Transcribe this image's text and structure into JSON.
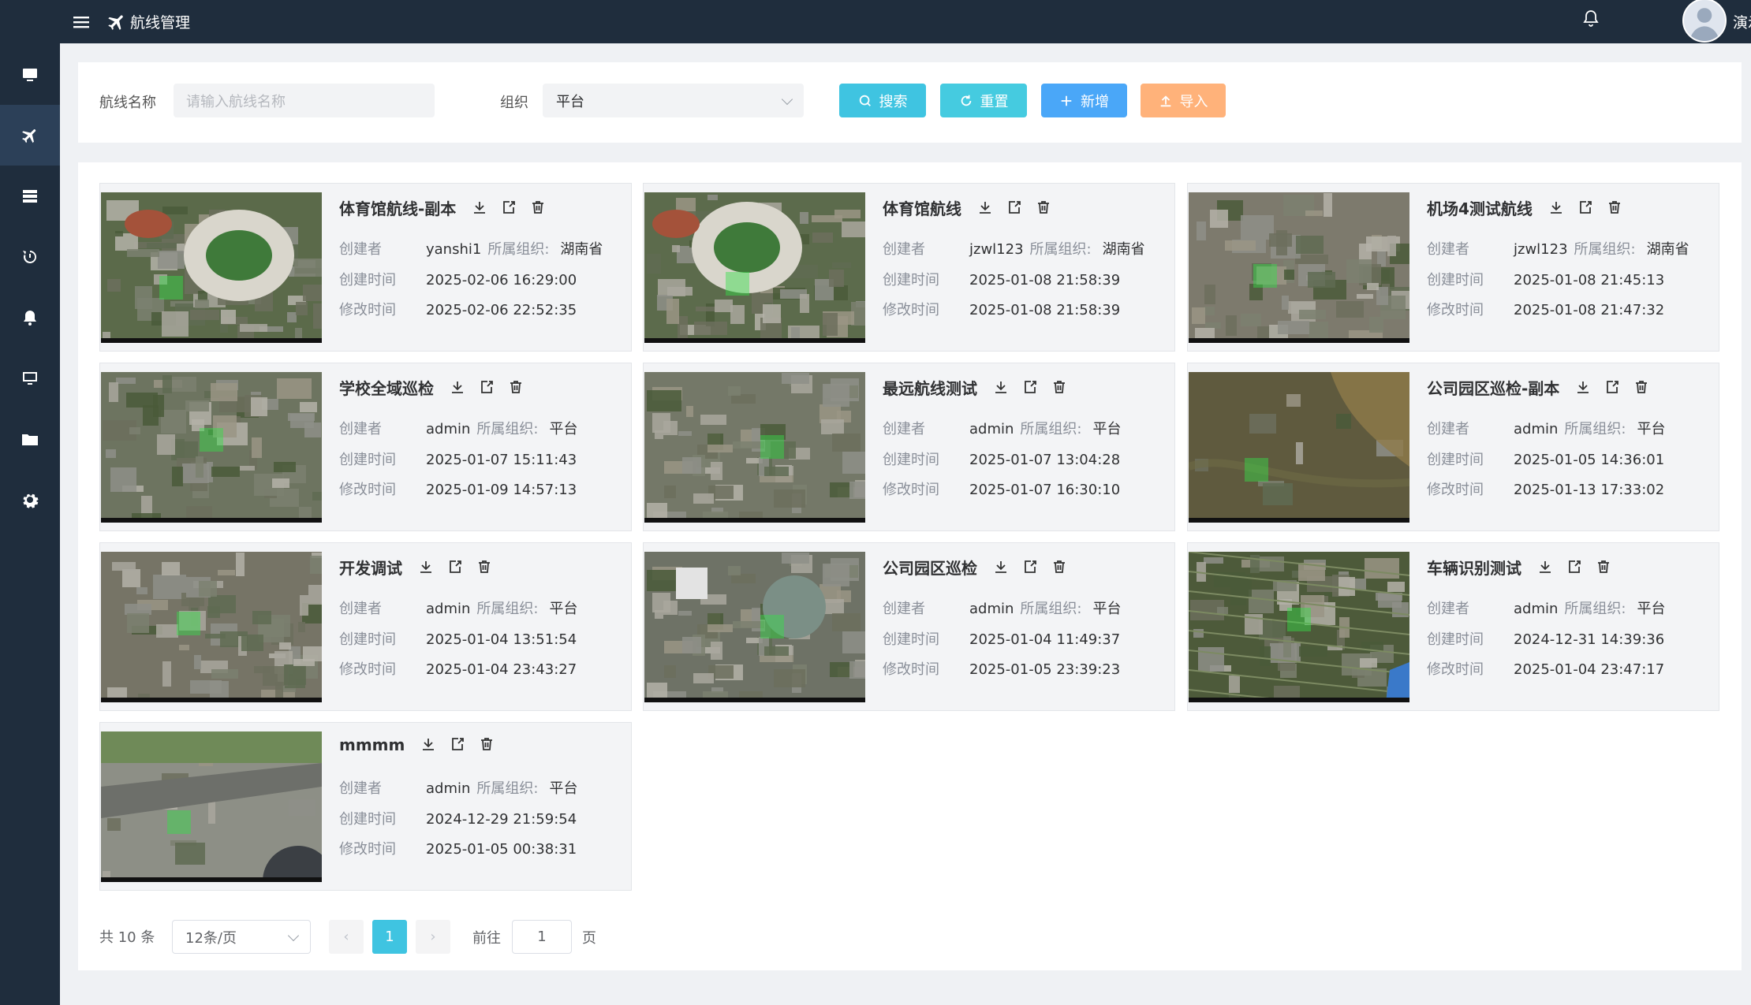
{
  "header": {
    "title": "航线管理",
    "user": "演示管理员"
  },
  "sidebar": {
    "items": [
      "monitor-icon",
      "plane-icon",
      "server-icon",
      "history-icon",
      "bell-icon",
      "screen-icon",
      "folder-icon",
      "gear-icon"
    ],
    "active_index": 1
  },
  "search": {
    "route_label": "航线名称",
    "route_placeholder": "请输入航线名称",
    "org_label": "组织",
    "org_value": "平台",
    "search_btn": "搜索",
    "reset_btn": "重置",
    "add_btn": "新增",
    "import_btn": "导入"
  },
  "colors": {
    "search": "#3fc4e1",
    "reset": "#45cbe0",
    "add": "#4aa7f8",
    "import": "#ffb27a"
  },
  "labels": {
    "creator": "创建者",
    "created": "创建时间",
    "modified": "修改时间",
    "org": "所属组织:"
  },
  "cards": [
    {
      "name": "体育馆航线-副本",
      "creator": "yanshi1",
      "org": "湖南省",
      "created": "2025-02-06 16:29:00",
      "modified": "2025-02-06 22:52:35",
      "thumb": "stadium"
    },
    {
      "name": "体育馆航线",
      "creator": "jzwl123",
      "org": "湖南省",
      "created": "2025-01-08 21:58:39",
      "modified": "2025-01-08 21:58:39",
      "thumb": "stadium2"
    },
    {
      "name": "机场4测试航线",
      "creator": "jzwl123",
      "org": "湖南省",
      "created": "2025-01-08 21:45:13",
      "modified": "2025-01-08 21:47:32",
      "thumb": "industrial"
    },
    {
      "name": "学校全域巡检",
      "creator": "admin",
      "org": "平台",
      "created": "2025-01-07 15:11:43",
      "modified": "2025-01-09 14:57:13",
      "thumb": "school"
    },
    {
      "name": "最远航线测试",
      "creator": "admin",
      "org": "平台",
      "created": "2025-01-07 13:04:28",
      "modified": "2025-01-07 16:30:10",
      "thumb": "city"
    },
    {
      "name": "公司园区巡检-副本",
      "creator": "admin",
      "org": "平台",
      "created": "2025-01-05 14:36:01",
      "modified": "2025-01-13 17:33:02",
      "thumb": "terrain"
    },
    {
      "name": "开发调试",
      "creator": "admin",
      "org": "平台",
      "created": "2025-01-04 13:51:54",
      "modified": "2025-01-04 23:43:27",
      "thumb": "city2"
    },
    {
      "name": "公司园区巡检",
      "creator": "admin",
      "org": "平台",
      "created": "2025-01-04 11:49:37",
      "modified": "2025-01-05 23:39:23",
      "thumb": "park"
    },
    {
      "name": "车辆识别测试",
      "creator": "admin",
      "org": "平台",
      "created": "2024-12-31 14:39:36",
      "modified": "2025-01-04 23:47:17",
      "thumb": "fields"
    },
    {
      "name": "mmmm",
      "creator": "admin",
      "org": "平台",
      "created": "2024-12-29 21:59:54",
      "modified": "2025-01-05 00:38:31",
      "thumb": "airport"
    }
  ],
  "pagination": {
    "total": "共 10 条",
    "page_size": "12条/页",
    "current": "1",
    "goto_label": "前往",
    "goto_value": "1",
    "page_unit": "页"
  }
}
